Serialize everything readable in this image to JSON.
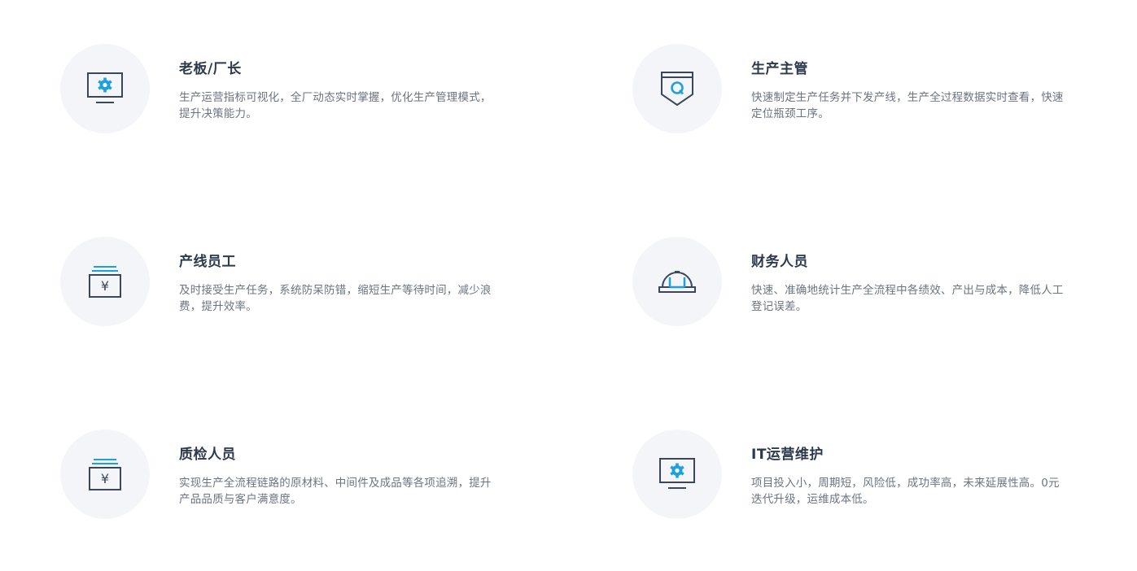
{
  "colors": {
    "background": "#ffffff",
    "icon_circle": "#f3f5f9",
    "title": "#2c3a4b",
    "description": "#6b7480",
    "icon_stroke": "#3b4656",
    "icon_accent": "#1ea0dc"
  },
  "roles": [
    {
      "title": "老板/厂长",
      "description": "生产运营指标可视化，全厂动态实时掌握，优化生产管理模式，提升决策能力。",
      "icon": "monitor-gear-icon"
    },
    {
      "title": "生产主管",
      "description": "快速制定生产任务并下发产线，生产全过程数据实时查看，快速定位瓶颈工序。",
      "icon": "quality-badge-icon"
    },
    {
      "title": "产线员工",
      "description": "及时接受生产任务，系统防呆防错，缩短生产等待时间，减少浪费，提升效率。",
      "icon": "yuan-box-icon"
    },
    {
      "title": "财务人员",
      "description": "快速、准确地统计生产全流程中各绩效、产出与成本，降低人工登记误差。",
      "icon": "hard-hat-icon"
    },
    {
      "title": "质检人员",
      "description": "实现生产全流程链路的原材料、中间件及成品等各项追溯，提升产品品质与客户满意度。",
      "icon": "yuan-box-icon"
    },
    {
      "title": "IT运营维护",
      "description": "项目投入小，周期短，风险低，成功率高，未来延展性高。0元迭代升级，运维成本低。",
      "icon": "monitor-gear-icon"
    }
  ]
}
